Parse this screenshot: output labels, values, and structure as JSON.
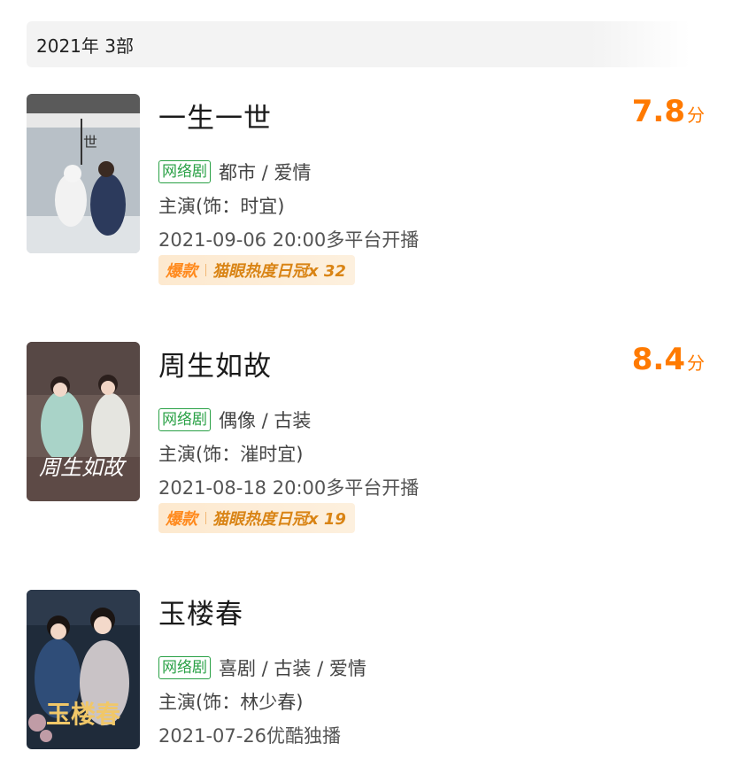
{
  "year_header": "2021年  3部",
  "items": [
    {
      "title": "一生一世",
      "score": "7.8",
      "score_unit": "分",
      "tag": "网络剧",
      "genre": "都市 / 爱情",
      "cast": "主演(饰：时宜)",
      "release": "2021-09-06 20:00多平台开播",
      "badge_hot": "爆款",
      "badge_rank": "猫眼热度日冠x 32",
      "poster_text": "一生一世"
    },
    {
      "title": "周生如故",
      "score": "8.4",
      "score_unit": "分",
      "tag": "网络剧",
      "genre": "偶像 / 古装",
      "cast": "主演(饰：漼时宜)",
      "release": "2021-08-18 20:00多平台开播",
      "badge_hot": "爆款",
      "badge_rank": "猫眼热度日冠x 19",
      "poster_text": "周生如故"
    },
    {
      "title": "玉楼春",
      "tag": "网络剧",
      "genre": "喜剧 / 古装 / 爱情",
      "cast": "主演(饰：林少春)",
      "release": "2021-07-26优酷独播",
      "poster_text": "玉楼春"
    }
  ],
  "colors": {
    "score": "#ff7a00",
    "tag": "#2aa146",
    "badge_bg": "#fdebd3",
    "badge_text": "#d98415"
  }
}
